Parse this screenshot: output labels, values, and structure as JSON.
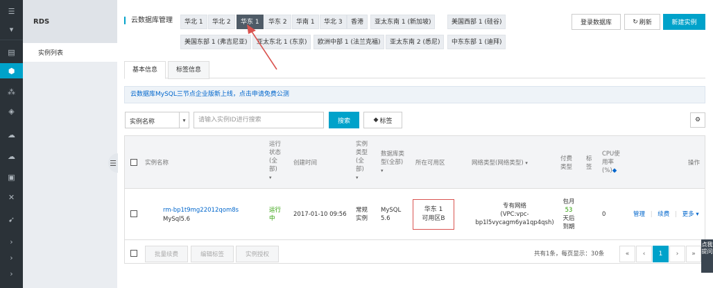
{
  "sidebar": {
    "title": "RDS",
    "items": [
      {
        "label": "实例列表"
      }
    ]
  },
  "header": {
    "title": "云数据库管理",
    "regions": [
      {
        "label": "华北 1",
        "active": false
      },
      {
        "label": "华北 2",
        "active": false
      },
      {
        "label": "华东 1",
        "active": true
      },
      {
        "label": "华东 2",
        "active": false
      },
      {
        "label": "华南 1",
        "active": false
      },
      {
        "label": "华北 3",
        "active": false
      },
      {
        "label": "香港",
        "active": false
      },
      {
        "label": "亚太东南 1 (新加坡)",
        "active": false
      },
      {
        "label": "美国西部 1 (硅谷)",
        "active": false
      },
      {
        "label": "美国东部 1 (弗吉尼亚)",
        "active": false
      },
      {
        "label": "亚太东北 1 (东京)",
        "active": false
      },
      {
        "label": "欧洲中部 1 (法兰克福)",
        "active": false
      },
      {
        "label": "亚太东南 2 (悉尼)",
        "active": false
      },
      {
        "label": "中东东部 1 (迪拜)",
        "active": false
      }
    ],
    "login_db_label": "登录数据库",
    "refresh_label": "刷新",
    "new_instance_label": "新建实例"
  },
  "tabs": [
    {
      "label": "基本信息",
      "active": true
    },
    {
      "label": "标签信息",
      "active": false
    }
  ],
  "notice": "云数据库MySQL三节点企业版新上线，点击申请免费公测",
  "search": {
    "field_selected": "实例名称",
    "placeholder": "请输入实例ID进行搜索",
    "search_label": "搜索",
    "tag_label": "标签"
  },
  "table": {
    "headers": {
      "name": "实例名称",
      "status_lines": [
        "运行",
        "状态",
        "(全",
        "部)"
      ],
      "created": "创建时间",
      "type_lines": [
        "实例",
        "类型",
        "(全",
        "部)"
      ],
      "dbtype_lines": [
        "数据库类",
        "型(全部)"
      ],
      "zone": "所在可用区",
      "network": "网络类型(网络类型)",
      "billing_lines": [
        "付费",
        "类型"
      ],
      "tags_lines": [
        "标",
        "签"
      ],
      "cpu_lines": [
        "CPU使",
        "用率",
        "(%)"
      ],
      "actions": "操作"
    },
    "row": {
      "id": "rm-bp1t9mg22012qom8s",
      "engine": "MySql5.6",
      "status_lines": [
        "运行",
        "中"
      ],
      "created": "2017-01-10 09:56",
      "type_lines": [
        "常规",
        "实例"
      ],
      "db_lines": [
        "MySQL",
        "5.6"
      ],
      "zone_lines": [
        "华东 1",
        "可用区B"
      ],
      "network_lines": [
        "专有网络",
        "(VPC:vpc-",
        "bp1l5vycagm6ya1qp4qsh)"
      ],
      "billing_lines": [
        "包月",
        "53",
        "天后",
        "到期"
      ],
      "cpu": "0",
      "action_manage": "管理",
      "action_renew": "续费",
      "action_more": "更多"
    },
    "footer": {
      "batch_renew": "批量续费",
      "edit_tags": "编辑标签",
      "instance_auth": "实例授权",
      "summary": "共有1条，每页显示：30条",
      "pages": [
        "«",
        "‹",
        "1",
        "›",
        "»"
      ]
    }
  },
  "feedback": "点我提问",
  "colors": {
    "accent": "#00a2ca",
    "active_region": "#4f5b67",
    "annotation": "#d9534f"
  }
}
